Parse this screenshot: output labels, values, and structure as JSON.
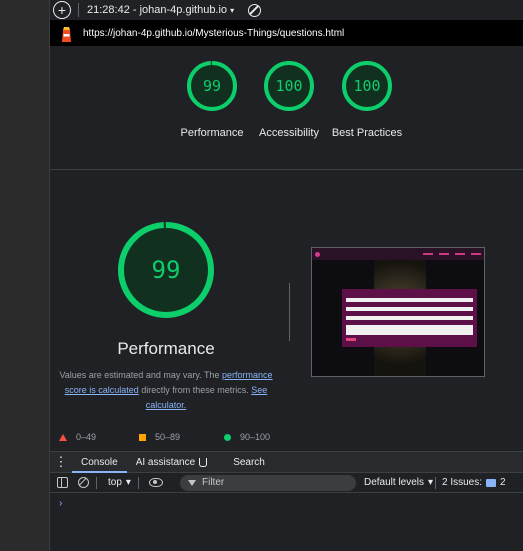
{
  "topbar": {
    "session_label": "21:28:42 - johan-4p.github.io",
    "add_symbol": "+",
    "caret": "▾"
  },
  "urlbar": {
    "url": "https://johan-4p.github.io/Mysterious-Things/questions.html"
  },
  "summary": {
    "gauges": [
      {
        "label": "Performance",
        "score": "99",
        "fraction": 0.99
      },
      {
        "label": "Accessibility",
        "score": "100",
        "fraction": 1.0
      },
      {
        "label": "Best Practices",
        "score": "100",
        "fraction": 1.0
      }
    ]
  },
  "detail": {
    "score": "99",
    "fraction": 0.99,
    "title": "Performance",
    "desc_before": "Values are estimated and may vary. The ",
    "desc_link1": "performance score is calculated",
    "desc_middle": " directly from these metrics. ",
    "desc_link2": "See calculator."
  },
  "legend": {
    "fail": "0–49",
    "average": "50–89",
    "pass": "90–100"
  },
  "drawer": {
    "tabs": [
      "Console",
      "AI assistance",
      "Search"
    ],
    "context": "top",
    "filter_placeholder": "Filter",
    "levels": "Default levels",
    "issues_label": "2 Issues:",
    "issues_count": "2",
    "prompt": "›"
  },
  "colors": {
    "pass": "#0cce6b",
    "average": "#ffa400",
    "fail": "#ff4e42",
    "link": "#8ab4f8"
  }
}
